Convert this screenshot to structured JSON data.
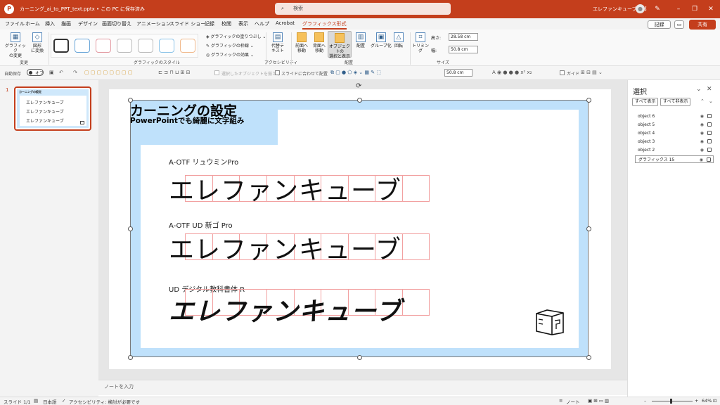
{
  "titlebar": {
    "filename": "カーニング_ai_to_PPT_text.pptx • この PC に保存済み",
    "search_placeholder": "検索",
    "user_name": "エレファンキューブ阿部",
    "app_letter": "P"
  },
  "menu": {
    "items": [
      "ファイル",
      "ホーム",
      "挿入",
      "描画",
      "デザイン",
      "画面切り替え",
      "アニメーション",
      "スライド ショー",
      "記録",
      "校閲",
      "表示",
      "ヘルプ",
      "Acrobat",
      "グラフィックス形式"
    ],
    "active": "グラフィックス形式",
    "record_label": "記録",
    "share_label": "共有"
  },
  "ribbon": {
    "change_group": {
      "label": "変更",
      "btn1": "グラフィック\nの変更",
      "btn2": "図形\nに変換"
    },
    "style_group": {
      "label": "グラフィックのスタイル",
      "fill": "グラフィックの塗りつぶし",
      "outline": "グラフィックの枠線",
      "effect": "グラフィックの効果"
    },
    "access_group": {
      "label": "アクセシビリティ",
      "alt_text": "代替テ\nキスト"
    },
    "arrange_group": {
      "label": "配置",
      "forward": "前面へ\n移動",
      "backward": "背面へ\n移動",
      "selection_pane": "オブジェクトの\n選択と表示",
      "align": "配置",
      "group": "グループ化",
      "rotate": "回転"
    },
    "size_group": {
      "label": "サイズ",
      "crop": "トリミング",
      "height_label": "高さ:",
      "height": "28.58 cm",
      "width_label": "幅:",
      "width": "50.8 cm"
    }
  },
  "qat": {
    "autosave": "自動保存",
    "autosave_state": "オフ",
    "disabled_hint": "選択したオブジェクトを揃える",
    "fit_slide": "スライドに合わせて配置",
    "width_value": "50.8 cm",
    "guide": "ガイド"
  },
  "thumbnail": {
    "number": "1",
    "title": "カーニングの設定",
    "lines": [
      "エレファンキューブ",
      "エレファンキューブ",
      "エレファンキューブ"
    ]
  },
  "slide": {
    "title": "カーニングの設定",
    "subtitle": "PowerPointでも綺麗に文字組み",
    "samples": [
      {
        "font": "A-OTF リュウミンPro",
        "text": "エレファンキューブ"
      },
      {
        "font": "A-OTF UD 新ゴ Pro",
        "text": "エレファンキューブ"
      },
      {
        "font": "UD デジタル教科書体 R",
        "text": "エレファンキューブ"
      }
    ]
  },
  "notes": {
    "placeholder": "ノートを入力"
  },
  "selection_pane": {
    "title": "選択",
    "show_all": "すべて表示",
    "hide_all": "すべて非表示",
    "objects": [
      "object 6",
      "object 5",
      "object 4",
      "object 3",
      "object 2",
      "グラフィックス 15"
    ],
    "selected": "グラフィックス 15"
  },
  "status": {
    "slide": "スライド 1/1",
    "language": "日本語",
    "accessibility": "アクセシビリティ: 検討が必要です",
    "notes_btn": "ノート",
    "zoom": "64%"
  }
}
